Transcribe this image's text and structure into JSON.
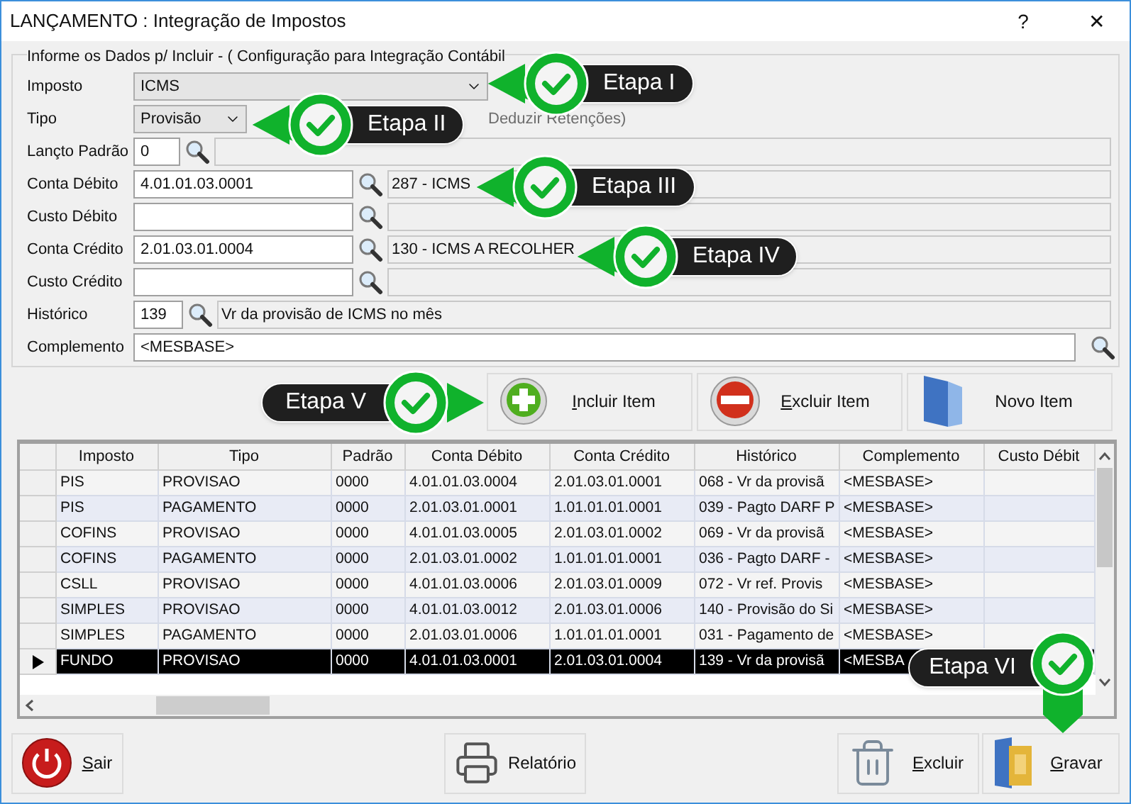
{
  "window": {
    "title": "LANÇAMENTO : Integração de Impostos",
    "help": "?",
    "close": "✕"
  },
  "form": {
    "legend": "Informe os Dados p/ Incluir - ( Configuração para Integração Contábil",
    "fields": [
      {
        "label": "Imposto",
        "kind": "select",
        "value": "ICMS"
      },
      {
        "label": "Tipo",
        "kind": "select",
        "value": "Provisão",
        "note": "Deduzir Retenções)"
      },
      {
        "label": "Lançto Padrão",
        "kind": "code",
        "value": "0"
      },
      {
        "label": "Conta Débito",
        "kind": "account",
        "value": "4.01.01.03.0001",
        "display": "287 - ICMS"
      },
      {
        "label": "Custo Débito",
        "kind": "account"
      },
      {
        "label": "Conta Crédito",
        "kind": "account",
        "value": "2.01.03.01.0004",
        "display": "130 - ICMS A RECOLHER"
      },
      {
        "label": "Custo Crédito",
        "kind": "account"
      },
      {
        "label": "Histórico",
        "kind": "code",
        "value": "139",
        "display": "Vr da provisão de ICMS no mês"
      },
      {
        "label": "Complemento",
        "kind": "text",
        "value": "<MESBASE>"
      }
    ]
  },
  "actions": [
    {
      "label": "Incluir Item",
      "kind": "add",
      "mnemonic": true
    },
    {
      "label": "Excluir Item",
      "kind": "remove",
      "mnemonic": true
    },
    {
      "label": "Novo Item",
      "kind": "new",
      "mnemonic": false
    }
  ],
  "grid": {
    "columns": [
      "Imposto",
      "Tipo",
      "Padrão",
      "Conta Débito",
      "Conta Crédito",
      "Histórico",
      "Complemento",
      "Custo Débit"
    ],
    "rows": [
      {
        "selected": false,
        "cells": [
          "PIS",
          "PROVISAO",
          "0000",
          "4.01.01.03.0004",
          "2.01.03.01.0001",
          "068 - Vr da provisã",
          "<MESBASE>"
        ]
      },
      {
        "selected": false,
        "cells": [
          "PIS",
          "PAGAMENTO",
          "0000",
          "2.01.03.01.0001",
          "1.01.01.01.0001",
          "039 - Pagto DARF P",
          "<MESBASE>"
        ]
      },
      {
        "selected": false,
        "cells": [
          "COFINS",
          "PROVISAO",
          "0000",
          "4.01.01.03.0005",
          "2.01.03.01.0002",
          "069 - Vr da provisã",
          "<MESBASE>"
        ]
      },
      {
        "selected": false,
        "cells": [
          "COFINS",
          "PAGAMENTO",
          "0000",
          "2.01.03.01.0002",
          "1.01.01.01.0001",
          "036 - Pagto DARF -",
          "<MESBASE>"
        ]
      },
      {
        "selected": false,
        "cells": [
          "CSLL",
          "PROVISAO",
          "0000",
          "4.01.01.03.0006",
          "2.01.03.01.0009",
          "072 - Vr ref. Provis",
          "<MESBASE>"
        ]
      },
      {
        "selected": false,
        "cells": [
          "SIMPLES",
          "PROVISAO",
          "0000",
          "4.01.01.03.0012",
          "2.01.03.01.0006",
          "140 - Provisão do Si",
          "<MESBASE>"
        ]
      },
      {
        "selected": false,
        "cells": [
          "SIMPLES",
          "PAGAMENTO",
          "0000",
          "2.01.03.01.0006",
          "1.01.01.01.0001",
          "031 - Pagamento de",
          "<MESBASE>"
        ]
      },
      {
        "selected": true,
        "cells": [
          "FUNDO",
          "PROVISAO",
          "0000",
          "4.01.01.03.0001",
          "2.01.03.01.0004",
          "139 - Vr da provisã",
          "<MESBA"
        ]
      }
    ]
  },
  "footer": [
    {
      "label": "Sair",
      "kind": "exit",
      "mnemonic": true
    },
    {
      "label": "Relatório",
      "kind": "print",
      "mnemonic": false
    },
    {
      "label": "Excluir",
      "kind": "delete",
      "mnemonic": true
    },
    {
      "label": "Gravar",
      "kind": "save",
      "mnemonic": true
    }
  ],
  "callouts": [
    {
      "label": "Etapa I"
    },
    {
      "label": "Etapa II"
    },
    {
      "label": "Etapa III"
    },
    {
      "label": "Etapa IV"
    },
    {
      "label": "Etapa V"
    },
    {
      "label": "Etapa VI"
    }
  ]
}
